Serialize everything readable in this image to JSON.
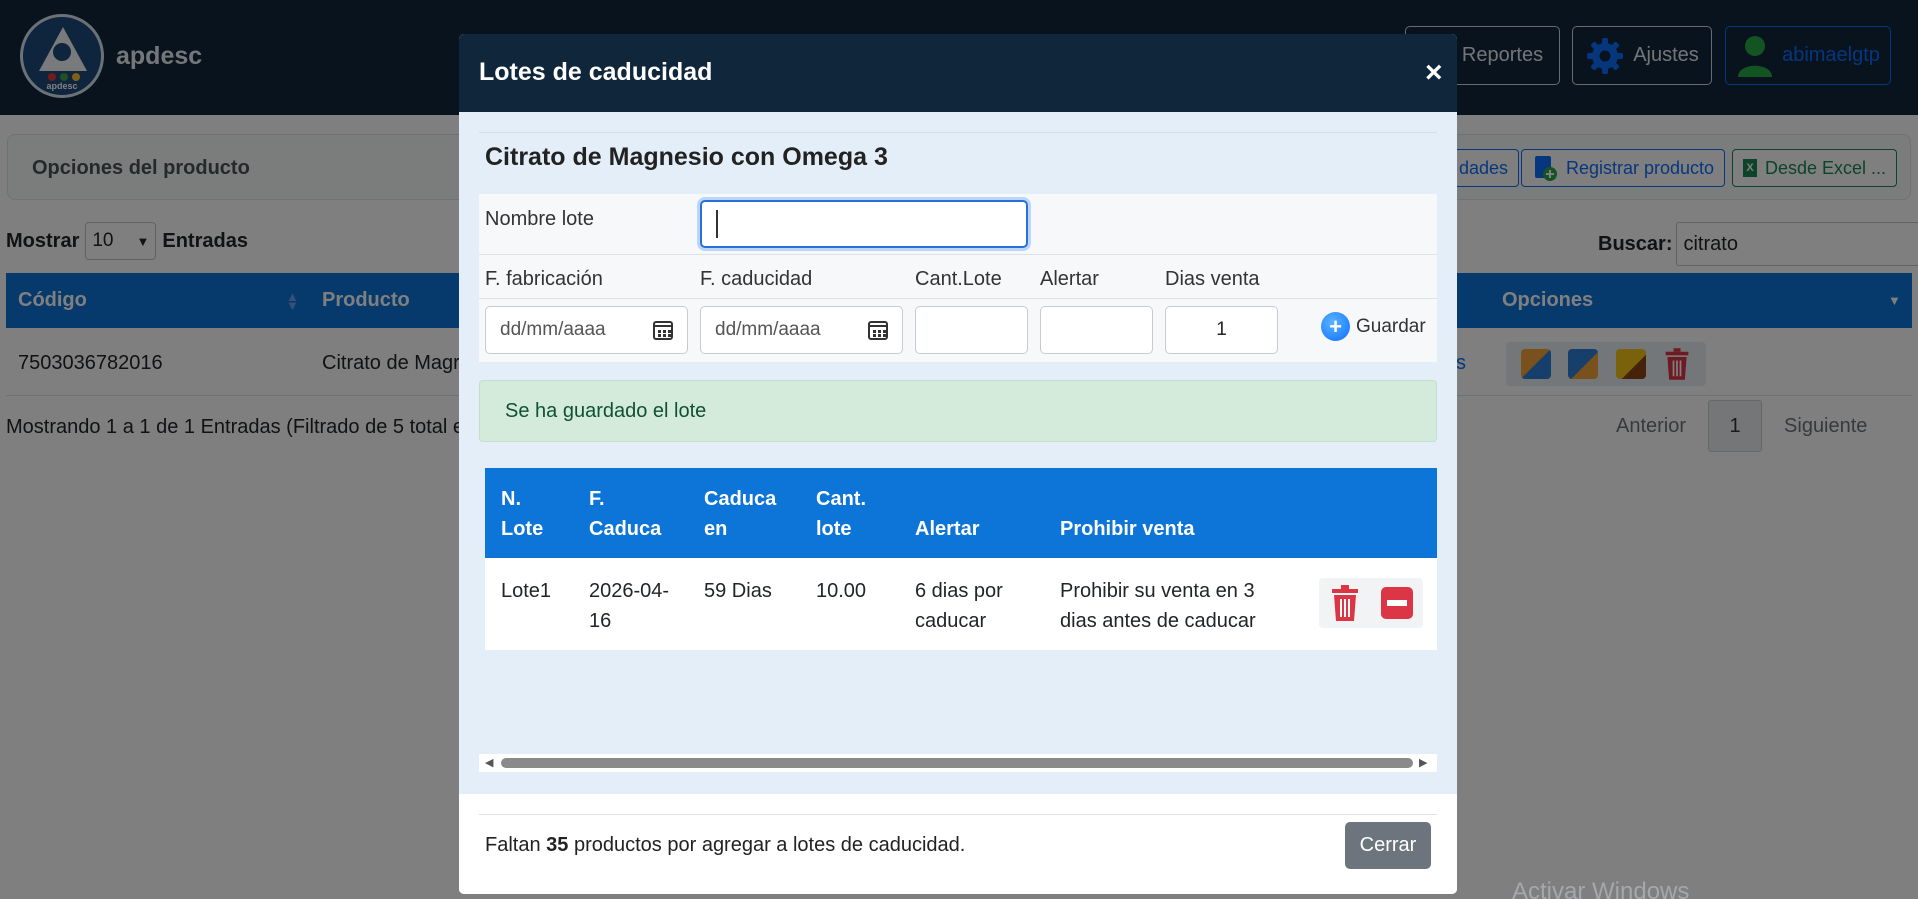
{
  "brand": {
    "name": "apdesc",
    "logo_text": "apdesc"
  },
  "navbar": {
    "reportes_label": "Reportes",
    "ajustes_label": "Ajustes",
    "user_label": "abimaelgtp"
  },
  "options_bar": {
    "title": "Opciones del producto",
    "btn_partial_label": "dades",
    "register_label": "Registrar producto",
    "excel_label": "Desde Excel ..."
  },
  "table_controls": {
    "show_label": "Mostrar",
    "show_value": "10",
    "entries_label": "Entradas",
    "search_label": "Buscar:",
    "search_value": "citrato"
  },
  "products_table": {
    "headers": {
      "codigo": "Código",
      "producto": "Producto",
      "opciones": "Opciones"
    },
    "row": {
      "codigo": "7503036782016",
      "producto": "Citrato de Magr",
      "partial": "s"
    },
    "info": "Mostrando 1 a 1 de 1 Entradas (Filtrado de 5 total e",
    "pager": {
      "prev": "Anterior",
      "page": "1",
      "next": "Siguiente"
    }
  },
  "watermark": "Activar Windows",
  "modal": {
    "title": "Lotes de caducidad",
    "close_symbol": "×",
    "product_name": "Citrato de Magnesio con Omega 3",
    "form": {
      "nombre_lote_label": "Nombre lote",
      "nombre_lote_value": "",
      "f_fabricacion_label": "F. fabricación",
      "f_caducidad_label": "F. caducidad",
      "cant_lote_label": "Cant.Lote",
      "alertar_label": "Alertar",
      "dias_venta_label": "Dias venta",
      "date_placeholder": "dd/mm/aaaa",
      "dias_venta_value": "1",
      "save_label": "Guardar"
    },
    "alert_message": "Se ha guardado el lote",
    "lotes_table": {
      "headers": [
        [
          "N.",
          "Lote"
        ],
        [
          "F.",
          "Caduca"
        ],
        [
          "Caduca",
          "en"
        ],
        [
          "Cant.",
          "lote"
        ],
        [
          "Alertar"
        ],
        [
          "Prohibir venta"
        ]
      ],
      "rows": [
        {
          "lote": "Lote1",
          "f_caduca": [
            "2026-04-",
            "16"
          ],
          "caduca_en": "59 Dias",
          "cant": "10.00",
          "alertar": [
            "6 dias por",
            "caducar"
          ],
          "prohibir": [
            "Prohibir su venta en 3",
            "dias antes de caducar"
          ]
        }
      ]
    },
    "footer": {
      "text_before": "Faltan ",
      "count": "35",
      "text_after": " productos por agregar a lotes de caducidad.",
      "close_label": "Cerrar"
    }
  },
  "colors": {
    "navbar_bg": "#10263a",
    "table_header_bg": "#0d74d8",
    "modal_body_bg": "#e3eef8",
    "success_bg": "#d4ebdc",
    "danger": "#dc3545",
    "secondary": "#6c757d",
    "primary": "#0d6efd"
  }
}
